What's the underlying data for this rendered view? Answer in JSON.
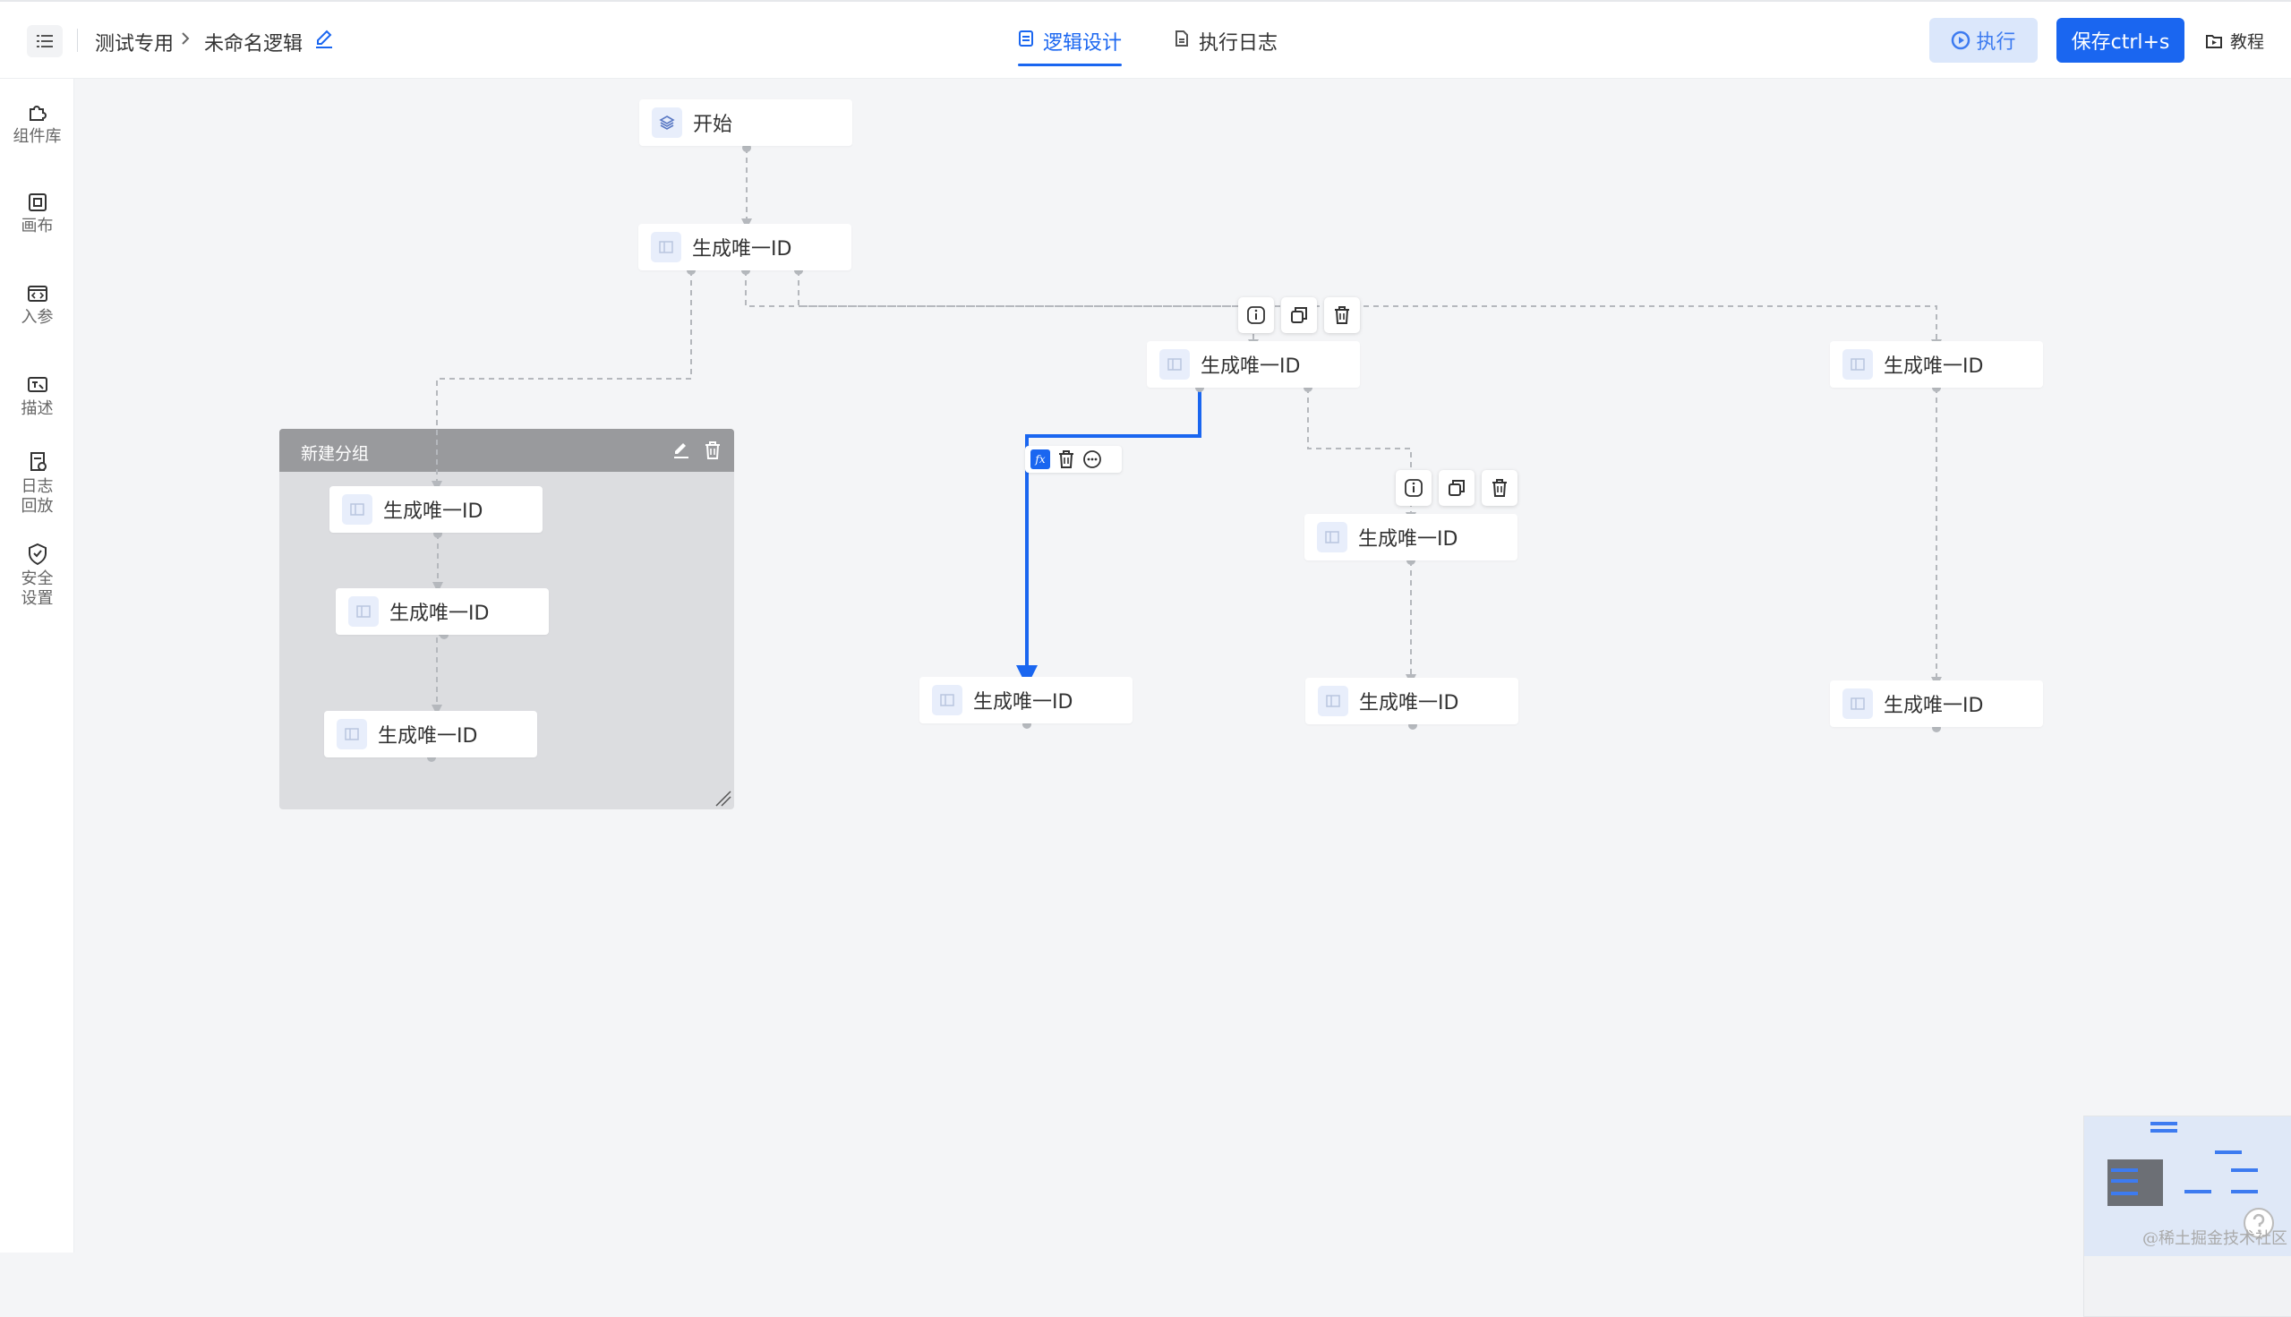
{
  "header": {
    "breadcrumb": [
      "测试专用",
      "未命名逻辑"
    ],
    "tabs": [
      {
        "label": "逻辑设计",
        "active": true
      },
      {
        "label": "执行日志",
        "active": false
      }
    ],
    "run_label": "执行",
    "save_label": "保存ctrl+s",
    "tutorial_label": "教程"
  },
  "sidebar": {
    "items": [
      {
        "label": "组件库",
        "icon": "puzzle-icon"
      },
      {
        "label": "画布",
        "icon": "canvas-icon"
      },
      {
        "label": "入参",
        "icon": "code-window-icon"
      },
      {
        "label": "描述",
        "icon": "description-icon"
      },
      {
        "label": "日志回放",
        "icon": "log-replay-icon"
      },
      {
        "label": "安全设置",
        "icon": "shield-check-icon"
      }
    ]
  },
  "canvas": {
    "start_node": {
      "label": "开始",
      "icon": "layers-icon"
    },
    "nodes": [
      {
        "label": "生成唯一ID"
      },
      {
        "label": "生成唯一ID"
      },
      {
        "label": "生成唯一ID"
      },
      {
        "label": "生成唯一ID"
      },
      {
        "label": "生成唯一ID"
      },
      {
        "label": "生成唯一ID"
      },
      {
        "label": "生成唯一ID"
      },
      {
        "label": "生成唯一ID"
      },
      {
        "label": "生成唯一ID"
      },
      {
        "label": "生成唯一ID"
      }
    ],
    "group": {
      "title": "新建分组"
    },
    "node_toolbar_icons": [
      "info-icon",
      "copy-icon",
      "delete-icon"
    ],
    "edge_toolbar_icons": [
      "fx-icon",
      "delete-icon",
      "more-icon"
    ]
  },
  "colors": {
    "accent": "#1a66f0",
    "selected_edge": "#1a66f0",
    "edge": "#b5b8bd",
    "group_header": "#999a9d",
    "group_body": "#dcdde0"
  },
  "watermark": "@稀土掘金技术社区"
}
